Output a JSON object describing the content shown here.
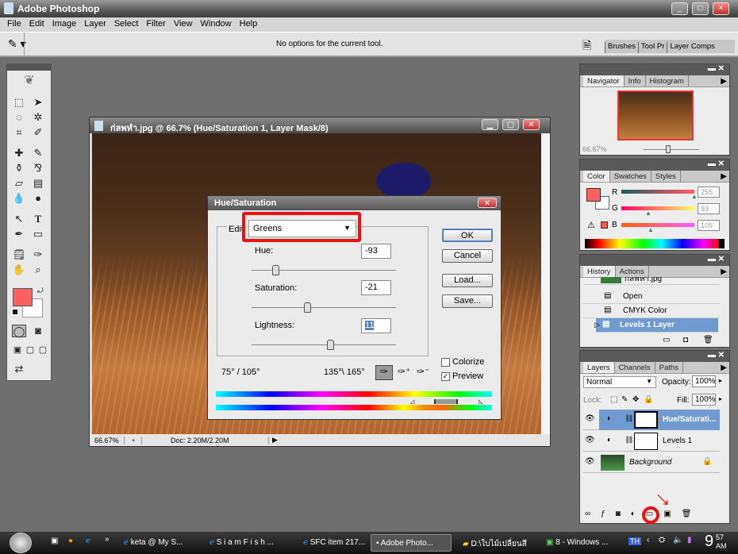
{
  "app": {
    "title": "Adobe Photoshop",
    "window_buttons": [
      "_",
      "□",
      "×"
    ]
  },
  "menu": [
    "File",
    "Edit",
    "Image",
    "Layer",
    "Select",
    "Filter",
    "View",
    "Window",
    "Help"
  ],
  "options": {
    "message": "No options for the current tool.",
    "palette_well_tabs": [
      "Brushes",
      "Tool Pr",
      "Layer Comps"
    ]
  },
  "colors": {
    "foreground": "#ff5f5f",
    "accent_selection": "#6f9bd0",
    "annotation_red": "#ee1111"
  },
  "document": {
    "title": "ก่ลพหำ.jpg @ 66.7% (Hue/Saturation 1, Layer Mask/8)",
    "zoom": "66.67%",
    "doc_info": "Doc: 2.20M/2.20M"
  },
  "dialog": {
    "title": "Hue/Saturation",
    "edit_label": "Edit:",
    "edit_value": "Greens",
    "hue_label": "Hue:",
    "hue_value": "-93",
    "saturation_label": "Saturation:",
    "saturation_value": "-21",
    "lightness_label": "Lightness:",
    "lightness_value": "11",
    "ok": "OK",
    "cancel": "Cancel",
    "load": "Load...",
    "save": "Save...",
    "colorize_label": "Colorize",
    "colorize_checked": false,
    "preview_label": "Preview",
    "preview_checked": true,
    "range_left": "75° / 105°",
    "range_right": "135°\\ 165°"
  },
  "navigator": {
    "tabs": [
      "Navigator",
      "Info",
      "Histogram"
    ],
    "zoom": "66.67%"
  },
  "color": {
    "tabs": [
      "Color",
      "Swatches",
      "Styles"
    ],
    "channels": [
      {
        "label": "R",
        "value": "255"
      },
      {
        "label": "G",
        "value": "93"
      },
      {
        "label": "B",
        "value": "105"
      }
    ]
  },
  "history": {
    "tabs": [
      "History",
      "Actions"
    ],
    "snapshot": "ก่ลพหำ.jpg",
    "items": [
      "Open",
      "CMYK Color",
      "Levels 1 Layer"
    ]
  },
  "layers": {
    "tabs": [
      "Layers",
      "Channels",
      "Paths"
    ],
    "blend_mode": "Normal",
    "opacity_label": "Opacity:",
    "opacity": "100%",
    "lock_label": "Lock:",
    "fill_label": "Fill:",
    "fill": "100%",
    "items": [
      {
        "name": "Hue/Saturati...",
        "selected": true
      },
      {
        "name": "Levels 1",
        "selected": false
      },
      {
        "name": "Background",
        "selected": false
      }
    ]
  },
  "taskbar": {
    "tasks": [
      "keta @ My S...",
      "S i a m F i s h ...",
      "SFC item 217...",
      "Adobe Photo...",
      "D:\\ใบไม้เปลี่ยนสี",
      "8 - Windows ..."
    ],
    "language": "TH",
    "time": "9",
    "time_minutes": "57",
    "time_ampm": "AM"
  }
}
